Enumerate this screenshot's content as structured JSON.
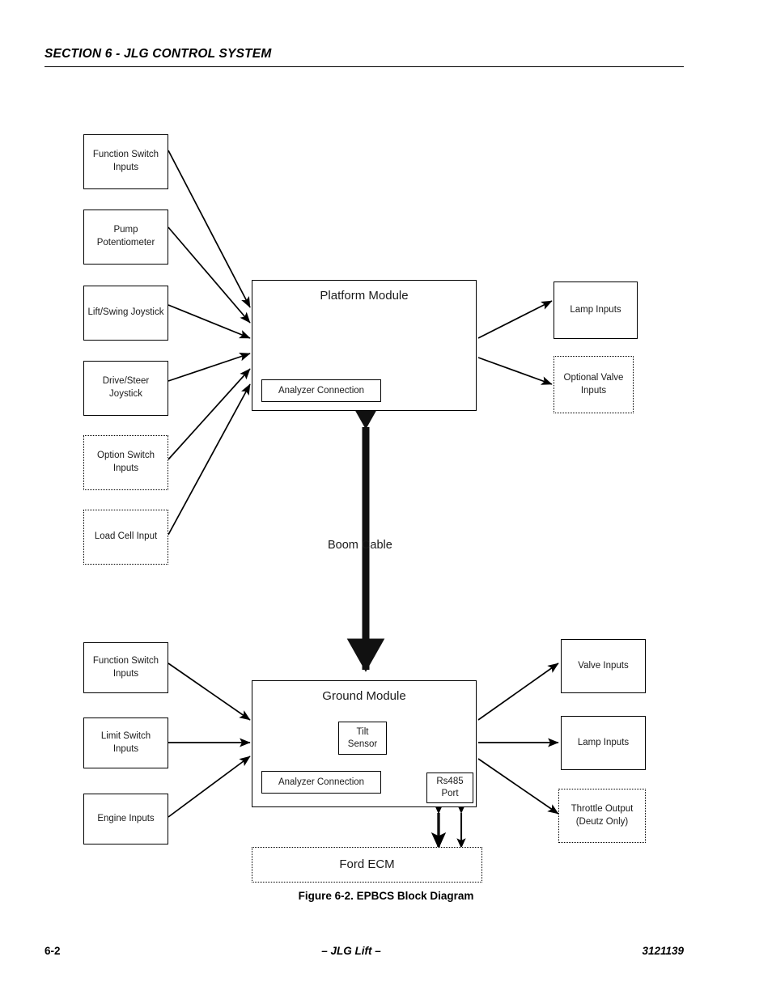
{
  "header": {
    "section_title": "SECTION 6 - JLG CONTROL SYSTEM"
  },
  "figure": {
    "caption": "Figure 6-2.  EPBCS Block Diagram",
    "boom_cable_label": "Boom Cable",
    "platform_inputs": [
      {
        "label": "Function Switch\nInputs",
        "style": "solid"
      },
      {
        "label": "Pump\nPotentiometer",
        "style": "solid"
      },
      {
        "label": "Lift/Swing Joystick",
        "style": "solid"
      },
      {
        "label": "Drive/Steer Joystick",
        "style": "solid"
      },
      {
        "label": "Option Switch\nInputs",
        "style": "dotted"
      },
      {
        "label": "Load Cell Input",
        "style": "dotted"
      }
    ],
    "platform_module": {
      "title": "Platform Module",
      "analyzer_connection": "Analyzer Connection"
    },
    "platform_outputs": [
      {
        "label": "Lamp Inputs",
        "style": "solid"
      },
      {
        "label": "Optional Valve\nInputs",
        "style": "dotted"
      }
    ],
    "ground_inputs": [
      {
        "label": "Function Switch\nInputs",
        "style": "solid"
      },
      {
        "label": "Limit Switch Inputs",
        "style": "solid"
      },
      {
        "label": "Engine Inputs",
        "style": "solid"
      }
    ],
    "ground_module": {
      "title": "Ground Module",
      "tilt_sensor": "Tilt\nSensor",
      "analyzer_connection": "Analyzer Connection",
      "rs485_port": "Rs485\nPort"
    },
    "ground_outputs": [
      {
        "label": "Valve Inputs",
        "style": "solid"
      },
      {
        "label": "Lamp Inputs",
        "style": "solid"
      },
      {
        "label": "Throttle Output\n(Deutz Only)",
        "style": "dotted"
      }
    ],
    "ecm": {
      "label": "Ford ECM",
      "style": "dotted"
    }
  },
  "footer": {
    "page_number": "6-2",
    "center": "– JLG Lift –",
    "document_number": "3121139"
  }
}
